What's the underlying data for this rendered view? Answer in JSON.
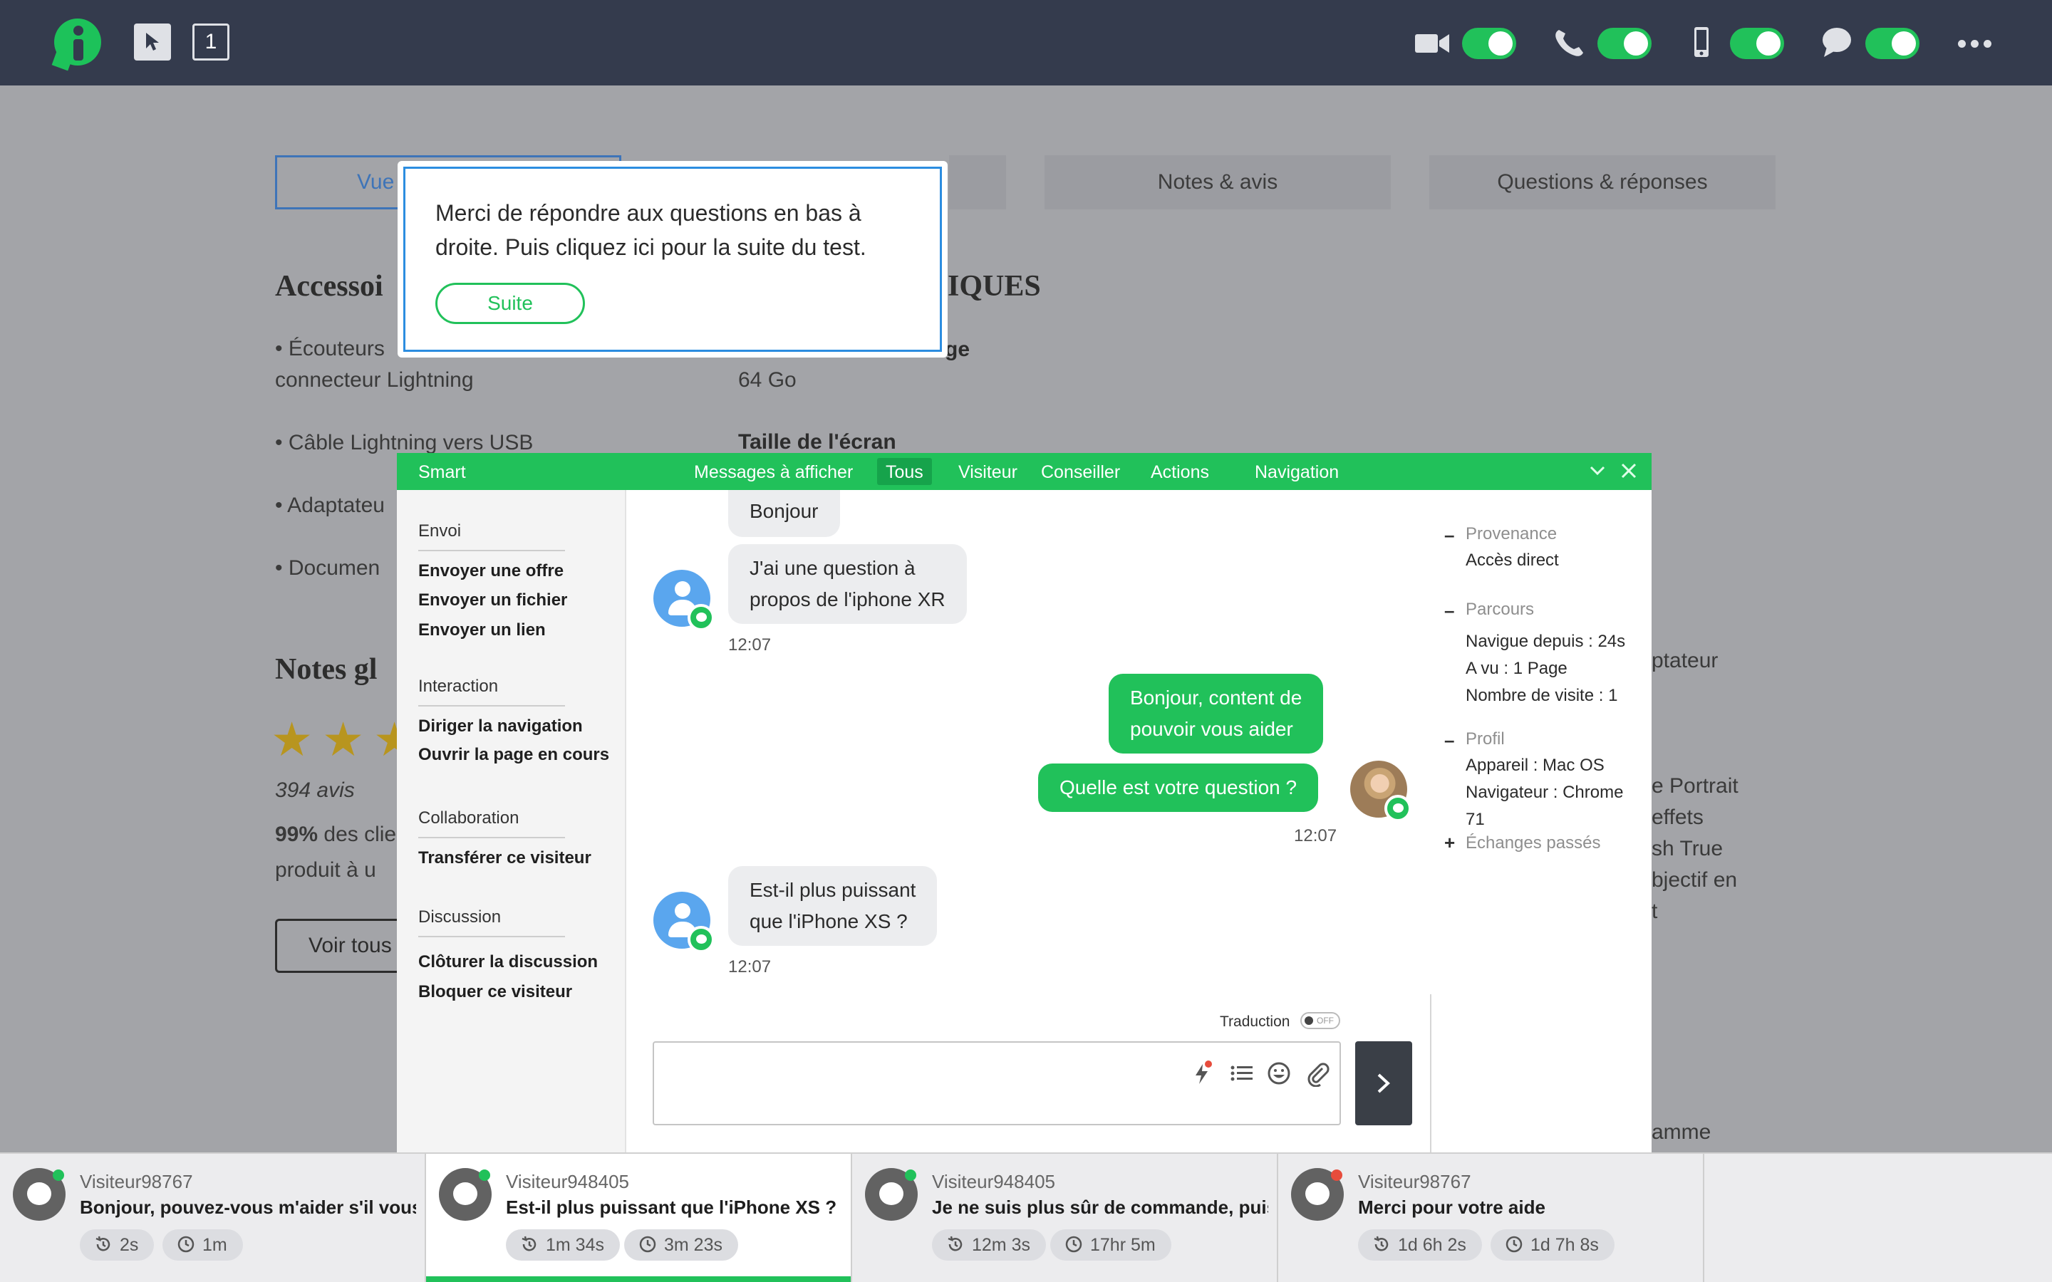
{
  "toolbar": {
    "page_count": "1"
  },
  "colors": {
    "accent": "#21c15a",
    "topbar": "#343b4d",
    "popup_border": "#2c8de0"
  },
  "product_page": {
    "tabs": [
      "Vue",
      "Notes & avis",
      "Questions & réponses"
    ],
    "accessories_title": "Accessoi",
    "accessories": [
      "• Écouteurs",
      "connecteur Lightning",
      "• Câble Lightning vers USB",
      "• Adaptateu",
      "• Documen"
    ],
    "specs_title": "IQUES",
    "storage_label": "ge",
    "storage_value": "64 Go",
    "screen_label": "Taille de l'écran",
    "reviews_title": "Notes gl",
    "reviews_count": "394 avis",
    "satisfaction_pct": "99%",
    "satisfaction_text": " des clie",
    "satisfaction_text2": "produit à u",
    "see_all": "Voir tous",
    "rating_stars": 3,
    "right_fragments": [
      "ptateur",
      "e Portrait",
      "effets",
      "sh True",
      "bjectif en",
      "t",
      "amme"
    ]
  },
  "popup": {
    "text": "Merci de répondre aux questions en bas à droite. Puis cliquez ici pour la suite du test.",
    "button": "Suite"
  },
  "panel": {
    "title": "Smart",
    "filter_label": "Messages à afficher",
    "filters": [
      "Tous",
      "Visiteur",
      "Conseiller",
      "Actions",
      "Navigation"
    ],
    "active_filter": "Tous",
    "sections": [
      {
        "title": "Envoi",
        "items": [
          "Envoyer une offre",
          "Envoyer un fichier",
          "Envoyer un lien"
        ]
      },
      {
        "title": "Interaction",
        "items": [
          "Diriger la navigation",
          "Ouvrir la page en cours"
        ]
      },
      {
        "title": "Collaboration",
        "items": [
          "Transférer ce visiteur"
        ]
      },
      {
        "title": "Discussion",
        "items": [
          "Clôturer la discussion",
          "Bloquer ce visiteur"
        ]
      }
    ],
    "messages": {
      "m1": "Bonjour",
      "m2a": "J'ai une question à",
      "m2b": "propos de l'iphone XR",
      "t1": "12:07",
      "m3a": "Bonjour, content de",
      "m3b": "pouvoir vous aider",
      "m4": "Quelle est votre question ?",
      "t2": "12:07",
      "m5a": "Est-il plus puissant",
      "m5b": "que l'iPhone XS ?",
      "t3": "12:07"
    },
    "composer": {
      "translation_label": "Traduction",
      "translation_state": "OFF",
      "placeholder": ""
    },
    "info": {
      "provenance_label": "Provenance",
      "provenance_value": "Accès direct",
      "parcours_label": "Parcours",
      "parcours_values": [
        "Navigue depuis : 24s",
        "A vu : 1 Page",
        "Nombre de visite : 1"
      ],
      "profil_label": "Profil",
      "profil_values": [
        "Appareil : Mac OS",
        "Navigateur : Chrome",
        "71"
      ],
      "past_label": "Échanges passés"
    }
  },
  "conversations": [
    {
      "name": "Visiteur98767",
      "message": "Bonjour, pouvez-vous m'aider s'il vous…",
      "chip1": "2s",
      "chip2": "1m",
      "status": "#21c15a"
    },
    {
      "name": "Visiteur948405",
      "message": "Est-il plus puissant que l'iPhone XS ?",
      "chip1": "1m 34s",
      "chip2": "3m 23s",
      "status": "#21c15a"
    },
    {
      "name": "Visiteur948405",
      "message": "Je ne suis plus sûr de commande, puis...",
      "chip1": "12m 3s",
      "chip2": "17hr 5m",
      "status": "#21c15a"
    },
    {
      "name": "Visiteur98767",
      "message": "Merci pour votre aide",
      "chip1": "1d 6h 2s",
      "chip2": "1d 7h 8s",
      "status": "#e74c3c"
    }
  ]
}
